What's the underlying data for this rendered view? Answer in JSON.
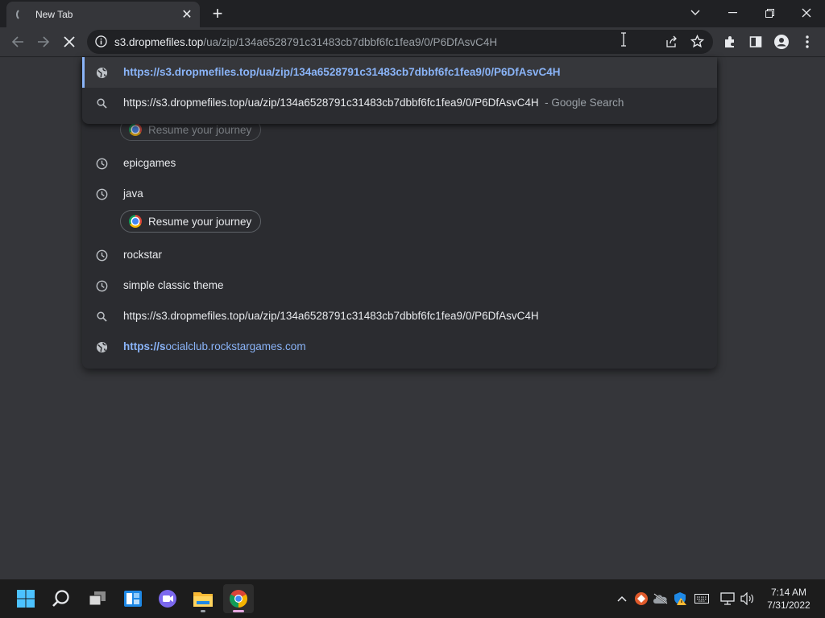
{
  "tab": {
    "title": "New Tab",
    "close_glyph": "✕",
    "new_tab_glyph": "+"
  },
  "window_controls": {
    "tab_search": "⌄",
    "minimize": "—",
    "restore": "❐",
    "close": "✕"
  },
  "toolbar": {
    "back": "←",
    "forward": "→",
    "stop": "✕",
    "omnibox_host": "s3.dropmefiles.top",
    "omnibox_path": "/ua/zip/134a6528791c31483cb7dbbf6fc1fea9/0/P6DfAsvC4H"
  },
  "suggestions": [
    {
      "icon": "globe-icon",
      "text": "https://s3.dropmefiles.top/ua/zip/134a6528791c31483cb7dbbf6fc1fea9/0/P6DfAsvC4H",
      "style": "link-bold",
      "selected": true
    },
    {
      "icon": "search-icon",
      "text": "https://s3.dropmefiles.top/ua/zip/134a6528791c31483cb7dbbf6fc1fea9/0/P6DfAsvC4H",
      "suffix": "- Google Search"
    },
    {
      "icon": "history-icon",
      "text": "epicgames"
    },
    {
      "icon": "history-icon",
      "text": "java"
    },
    {
      "icon": "history-icon",
      "text": "rockstar"
    },
    {
      "icon": "history-icon",
      "text": "simple classic theme"
    },
    {
      "icon": "search-icon",
      "text": "https://s3.dropmefiles.top/ua/zip/134a6528791c31483cb7dbbf6fc1fea9/0/P6DfAsvC4H"
    },
    {
      "icon": "globe-icon",
      "text_bold": "https://s",
      "text_rest": "ocialclub.rockstargames.com",
      "style": "link"
    }
  ],
  "journey_chips": [
    {
      "label": "Resume your journey"
    },
    {
      "label": "Resume your journey"
    }
  ],
  "taskbar": {
    "apps": [
      "start-icon",
      "search-icon",
      "task-view-icon",
      "widgets-icon",
      "teams-chat-icon",
      "file-explorer-icon",
      "chrome-icon"
    ],
    "active_app": "chrome-icon",
    "tray": [
      "chevron-up-icon",
      "app-tray-icon",
      "onedrive-icon",
      "defender-icon",
      "keyboard-icon",
      "network-icon",
      "volume-icon"
    ]
  },
  "clock": {
    "time": "7:14 AM",
    "date": "7/31/2022"
  },
  "colors": {
    "accent_link": "#8ab4f8",
    "tab_strip": "#202124",
    "toolbar": "#35363a",
    "dropdown": "#2b2c30"
  }
}
